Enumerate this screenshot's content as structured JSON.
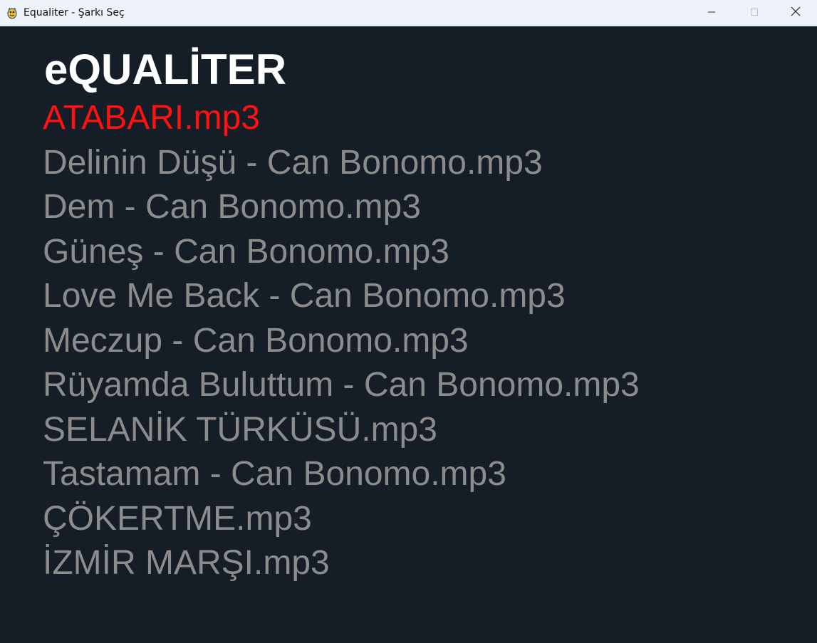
{
  "window": {
    "title": "Equaliter - Şarkı Seç"
  },
  "app": {
    "title": "eQUALİTER"
  },
  "songs": [
    "ATABARI.mp3",
    "Delinin Düşü - Can Bonomo.mp3",
    "Dem - Can Bonomo.mp3",
    "Güneş - Can Bonomo.mp3",
    "Love Me Back - Can Bonomo.mp3",
    "Meczup - Can Bonomo.mp3",
    "Rüyamda Buluttum - Can Bonomo.mp3",
    "SELANİK TÜRKÜSÜ.mp3",
    "Tastamam - Can Bonomo.mp3",
    "ÇÖKERTME.mp3",
    "İZMİR MARŞI.mp3"
  ],
  "selected_index": 0,
  "colors": {
    "background": "#151d27",
    "title": "#ffffff",
    "song": "#8c8c8c",
    "selected_song": "#ff1111"
  },
  "icons": {
    "app": "pygame-snake-icon",
    "minimize": "minimize-icon",
    "maximize": "maximize-icon",
    "close": "close-icon"
  }
}
